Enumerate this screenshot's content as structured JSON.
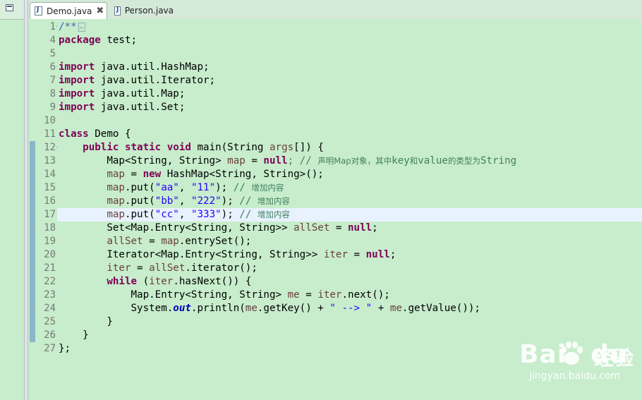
{
  "tabs": [
    {
      "label": "Demo.java",
      "active": true,
      "closable": true,
      "icon": "java-file-icon"
    },
    {
      "label": "Person.java",
      "active": false,
      "closable": false,
      "icon": "java-file-icon"
    }
  ],
  "tab_close_glyph": "✖",
  "current_line": "17",
  "editor": {
    "line_numbers": [
      "1",
      "4",
      "5",
      "6",
      "7",
      "8",
      "9",
      "10",
      "11",
      "12",
      "13",
      "14",
      "15",
      "16",
      "17",
      "18",
      "19",
      "20",
      "21",
      "22",
      "23",
      "24",
      "25",
      "26",
      "27"
    ],
    "fold_markers": {
      "1": "+",
      "6": "−",
      "12": "−"
    },
    "lines": [
      [
        {
          "t": "/**",
          "c": "doc"
        },
        {
          "t": "…",
          "c": "collapsed"
        }
      ],
      [
        {
          "t": "package",
          "c": "kw"
        },
        {
          "t": " test;",
          "c": ""
        }
      ],
      [],
      [
        {
          "t": "import",
          "c": "kw"
        },
        {
          "t": " java.util.HashMap;",
          "c": ""
        }
      ],
      [
        {
          "t": "import",
          "c": "kw"
        },
        {
          "t": " java.util.Iterator;",
          "c": ""
        }
      ],
      [
        {
          "t": "import",
          "c": "kw"
        },
        {
          "t": " java.util.Map;",
          "c": ""
        }
      ],
      [
        {
          "t": "import",
          "c": "kw"
        },
        {
          "t": " java.util.Set;",
          "c": ""
        }
      ],
      [],
      [
        {
          "t": "class",
          "c": "kw"
        },
        {
          "t": " Demo {",
          "c": ""
        }
      ],
      [
        {
          "t": "    ",
          "c": ""
        },
        {
          "t": "public",
          "c": "kw"
        },
        {
          "t": " ",
          "c": ""
        },
        {
          "t": "static",
          "c": "kw"
        },
        {
          "t": " ",
          "c": ""
        },
        {
          "t": "void",
          "c": "kw"
        },
        {
          "t": " main(String ",
          "c": ""
        },
        {
          "t": "args",
          "c": "var"
        },
        {
          "t": "[]) {",
          "c": ""
        }
      ],
      [
        {
          "t": "        Map<String, String> ",
          "c": ""
        },
        {
          "t": "map",
          "c": "var"
        },
        {
          "t": " = ",
          "c": ""
        },
        {
          "t": "null",
          "c": "kw"
        },
        {
          "t": "; // ",
          "c": "cmt"
        },
        {
          "t": "声明Map对象，其中",
          "c": "cmt-cn"
        },
        {
          "t": "key",
          "c": "cmt"
        },
        {
          "t": "和",
          "c": "cmt-cn"
        },
        {
          "t": "value",
          "c": "cmt"
        },
        {
          "t": "的类型为",
          "c": "cmt-cn"
        },
        {
          "t": "String",
          "c": "cmt"
        }
      ],
      [
        {
          "t": "        ",
          "c": ""
        },
        {
          "t": "map",
          "c": "var"
        },
        {
          "t": " = ",
          "c": ""
        },
        {
          "t": "new",
          "c": "kw"
        },
        {
          "t": " HashMap<String, String>();",
          "c": ""
        }
      ],
      [
        {
          "t": "        ",
          "c": ""
        },
        {
          "t": "map",
          "c": "var"
        },
        {
          "t": ".put(",
          "c": ""
        },
        {
          "t": "\"aa\"",
          "c": "str"
        },
        {
          "t": ", ",
          "c": ""
        },
        {
          "t": "\"11\"",
          "c": "str"
        },
        {
          "t": "); ",
          "c": ""
        },
        {
          "t": "// ",
          "c": "cmt"
        },
        {
          "t": "增加内容",
          "c": "cmt-cn"
        }
      ],
      [
        {
          "t": "        ",
          "c": ""
        },
        {
          "t": "map",
          "c": "var"
        },
        {
          "t": ".put(",
          "c": ""
        },
        {
          "t": "\"bb\"",
          "c": "str"
        },
        {
          "t": ", ",
          "c": ""
        },
        {
          "t": "\"222\"",
          "c": "str"
        },
        {
          "t": "); ",
          "c": ""
        },
        {
          "t": "// ",
          "c": "cmt"
        },
        {
          "t": "增加内容",
          "c": "cmt-cn"
        }
      ],
      [
        {
          "t": "        ",
          "c": ""
        },
        {
          "t": "map",
          "c": "var"
        },
        {
          "t": ".put(",
          "c": ""
        },
        {
          "t": "\"cc\"",
          "c": "str"
        },
        {
          "t": ", ",
          "c": ""
        },
        {
          "t": "\"333\"",
          "c": "str"
        },
        {
          "t": "); ",
          "c": ""
        },
        {
          "t": "// ",
          "c": "cmt"
        },
        {
          "t": "增加内容",
          "c": "cmt-cn"
        }
      ],
      [
        {
          "t": "        Set<Map.Entry<String, String>> ",
          "c": ""
        },
        {
          "t": "allSet",
          "c": "var"
        },
        {
          "t": " = ",
          "c": ""
        },
        {
          "t": "null",
          "c": "kw"
        },
        {
          "t": ";",
          "c": ""
        }
      ],
      [
        {
          "t": "        ",
          "c": ""
        },
        {
          "t": "allSet",
          "c": "var"
        },
        {
          "t": " = ",
          "c": ""
        },
        {
          "t": "map",
          "c": "var"
        },
        {
          "t": ".entrySet();",
          "c": ""
        }
      ],
      [
        {
          "t": "        Iterator<Map.Entry<String, String>> ",
          "c": ""
        },
        {
          "t": "iter",
          "c": "var"
        },
        {
          "t": " = ",
          "c": ""
        },
        {
          "t": "null",
          "c": "kw"
        },
        {
          "t": ";",
          "c": ""
        }
      ],
      [
        {
          "t": "        ",
          "c": ""
        },
        {
          "t": "iter",
          "c": "var"
        },
        {
          "t": " = ",
          "c": ""
        },
        {
          "t": "allSet",
          "c": "var"
        },
        {
          "t": ".iterator();",
          "c": ""
        }
      ],
      [
        {
          "t": "        ",
          "c": ""
        },
        {
          "t": "while",
          "c": "kw"
        },
        {
          "t": " (",
          "c": ""
        },
        {
          "t": "iter",
          "c": "var"
        },
        {
          "t": ".hasNext()) {",
          "c": ""
        }
      ],
      [
        {
          "t": "            Map.Entry<String, String> ",
          "c": ""
        },
        {
          "t": "me",
          "c": "var"
        },
        {
          "t": " = ",
          "c": ""
        },
        {
          "t": "iter",
          "c": "var"
        },
        {
          "t": ".next();",
          "c": ""
        }
      ],
      [
        {
          "t": "            System.",
          "c": ""
        },
        {
          "t": "out",
          "c": "static-field"
        },
        {
          "t": ".println(",
          "c": ""
        },
        {
          "t": "me",
          "c": "var"
        },
        {
          "t": ".getKey() + ",
          "c": ""
        },
        {
          "t": "\" --> \"",
          "c": "str"
        },
        {
          "t": " + ",
          "c": ""
        },
        {
          "t": "me",
          "c": "var"
        },
        {
          "t": ".getValue());",
          "c": ""
        }
      ],
      [
        {
          "t": "        }",
          "c": ""
        }
      ],
      [
        {
          "t": "    }",
          "c": ""
        }
      ],
      [
        {
          "t": "};",
          "c": ""
        }
      ]
    ],
    "change_marked_lines": [
      "12",
      "13",
      "14",
      "15",
      "16",
      "17",
      "18",
      "19",
      "20",
      "21",
      "22",
      "23",
      "24",
      "25",
      "26"
    ]
  },
  "watermark": {
    "brand": "Bai",
    "brand_suffix": "du",
    "product": "经验",
    "url": "jingyan.baidu.com"
  },
  "colors": {
    "background": "#c7edcc",
    "keyword": "#7f0055",
    "string": "#2a00ff",
    "comment": "#3f7f5f",
    "local_variable": "#6a3e3e",
    "current_line": "#e8f2fe"
  }
}
